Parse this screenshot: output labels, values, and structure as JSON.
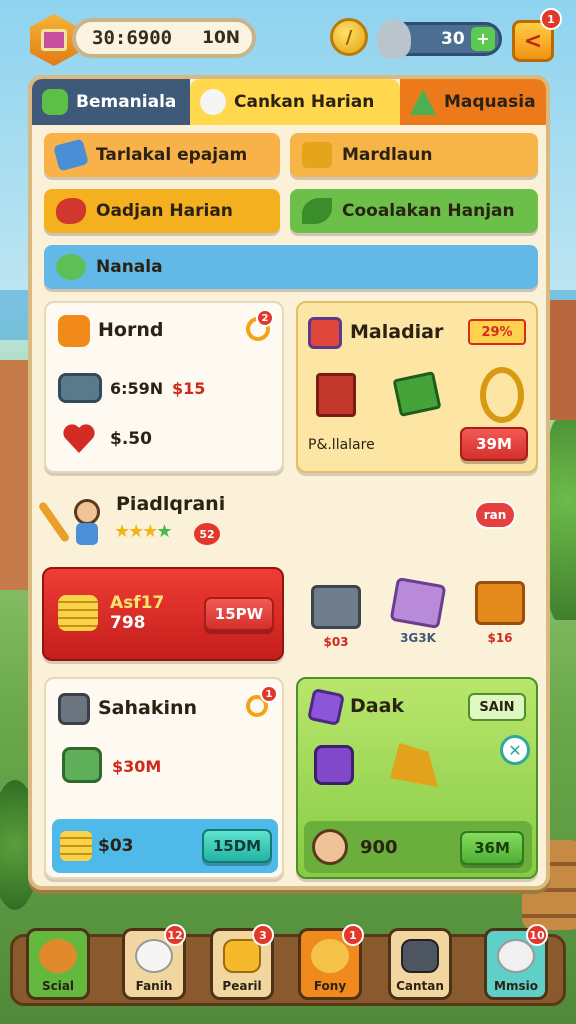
{
  "topbar": {
    "coins_value": "30:6900",
    "coins_suffix": "10N",
    "energy_value": "30",
    "energy_plus": "+",
    "back_glyph": "<",
    "back_badge": "1"
  },
  "tabs": [
    {
      "label": "Bemaniala",
      "icon": "leaf-icon"
    },
    {
      "label": "Cankan Harian",
      "icon": "sheep-icon"
    },
    {
      "label": "Maquasia",
      "icon": "mountain-icon"
    }
  ],
  "missions": [
    {
      "label": "Tarlakal epajam",
      "icon": "ticket-icon"
    },
    {
      "label": "Mardlaun",
      "icon": "crate-icon"
    },
    {
      "label": "Oadjan Harian",
      "icon": "meat-icon"
    },
    {
      "label": "Cooalakan Hanjan",
      "icon": "leaf-icon"
    },
    {
      "label": "Nanala",
      "icon": "frog-icon"
    }
  ],
  "hourly_card": {
    "title": "Hornd",
    "badge": "2",
    "row1_label": "6:59N",
    "row1_value": "$15",
    "row2_value": "$.50"
  },
  "material_card": {
    "title": "Maladiar",
    "tag": "29%",
    "footer": "P&.llalare",
    "price": "39M"
  },
  "promo": {
    "title": "Piadlqrani",
    "stars": "★★★",
    "stars_green": "★",
    "badge": "52",
    "new_label": "ran"
  },
  "red_offer": {
    "label": "Asf17",
    "value": "798",
    "price": "15PW"
  },
  "mini_items": [
    {
      "label": "$03",
      "icon": "chest-icon"
    },
    {
      "label": "3G3K",
      "icon": "potion-icon"
    },
    {
      "label": "$16",
      "icon": "box-icon"
    }
  ],
  "shop_card": {
    "title": "Sahakinn",
    "badge": "1",
    "item_value": "$30M",
    "bar_value": "$03",
    "price": "15DM"
  },
  "green_card": {
    "title": "Daak",
    "tag": "SAIN",
    "close_glyph": "✕",
    "bar_value": "900",
    "price": "36M"
  },
  "nav": [
    {
      "label": "Scial",
      "badge": "",
      "icon": "bear-icon"
    },
    {
      "label": "Fanih",
      "badge": "12",
      "icon": "sheep-icon"
    },
    {
      "label": "Pearil",
      "badge": "3",
      "icon": "gold-bar-icon"
    },
    {
      "label": "Fony",
      "badge": "1",
      "icon": "bear-icon"
    },
    {
      "label": "Cantan",
      "badge": "",
      "icon": "safe-icon"
    },
    {
      "label": "Mmsio",
      "badge": "10",
      "icon": "sheep-icon"
    }
  ]
}
